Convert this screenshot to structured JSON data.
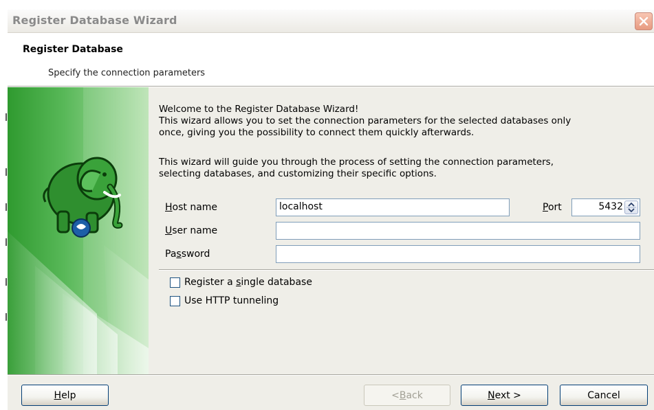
{
  "window": {
    "title": "Register Database Wizard",
    "close_icon": "close-icon"
  },
  "header": {
    "title": "Register Database",
    "subtitle": "Specify the connection parameters"
  },
  "content": {
    "welcome_line1": "Welcome to the Register Database Wizard!",
    "welcome_line2": "This wizard allows you to set the connection parameters for the selected databases only",
    "welcome_line3": "once, giving you the possibility to connect them quickly afterwards.",
    "guide_line1": "This wizard will guide you through the process of setting the connection parameters,",
    "guide_line2": "selecting databases, and customizing their specific options."
  },
  "form": {
    "host_label_u": "H",
    "host_label_rest": "ost name",
    "host_value": "localhost",
    "port_label_u": "P",
    "port_label_rest": "ort",
    "port_value": "5432",
    "user_label_u": "U",
    "user_label_rest": "ser name",
    "user_value": "",
    "password_label_pre": "Pa",
    "password_label_u": "s",
    "password_label_rest": "sword",
    "password_value": ""
  },
  "options": {
    "single_db_pre": "Register a ",
    "single_db_u": "s",
    "single_db_rest": "ingle database",
    "single_db_checked": false,
    "http_label": "Use HTTP tunneling",
    "http_checked": false
  },
  "footer": {
    "help_u": "H",
    "help_rest": "elp",
    "back_pre": "< ",
    "back_u": "B",
    "back_rest": "ack",
    "next_u": "N",
    "next_rest": "ext >",
    "cancel": "Cancel"
  },
  "colors": {
    "accent_green": "#3aa23a",
    "button_border": "#003c74",
    "close_button": "#e79a80"
  }
}
